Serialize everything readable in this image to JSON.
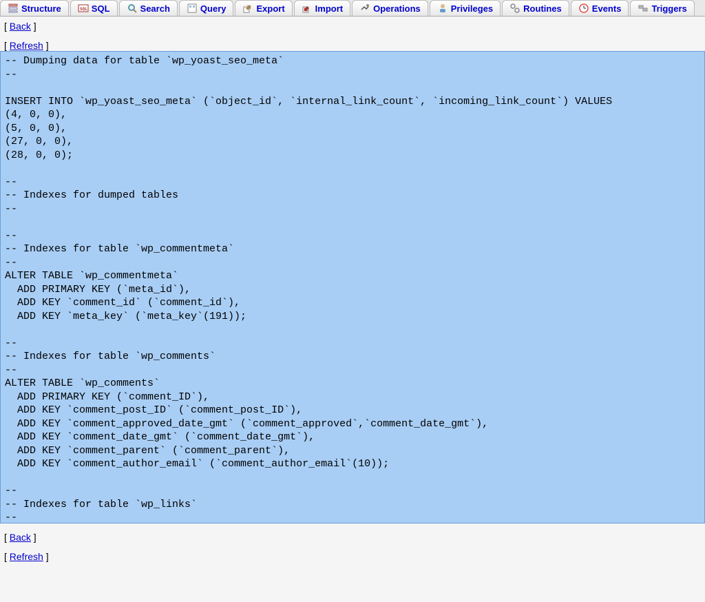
{
  "tabs": [
    {
      "label": "Structure",
      "icon": "structure-icon"
    },
    {
      "label": "SQL",
      "icon": "sql-icon"
    },
    {
      "label": "Search",
      "icon": "search-icon"
    },
    {
      "label": "Query",
      "icon": "query-icon"
    },
    {
      "label": "Export",
      "icon": "export-icon"
    },
    {
      "label": "Import",
      "icon": "import-icon"
    },
    {
      "label": "Operations",
      "icon": "operations-icon"
    },
    {
      "label": "Privileges",
      "icon": "privileges-icon"
    },
    {
      "label": "Routines",
      "icon": "routines-icon"
    },
    {
      "label": "Events",
      "icon": "events-icon"
    },
    {
      "label": "Triggers",
      "icon": "triggers-icon"
    }
  ],
  "links": {
    "back": "Back",
    "refresh": "Refresh"
  },
  "sql_text": "-- Dumping data for table `wp_yoast_seo_meta`\n--\n\nINSERT INTO `wp_yoast_seo_meta` (`object_id`, `internal_link_count`, `incoming_link_count`) VALUES\n(4, 0, 0),\n(5, 0, 0),\n(27, 0, 0),\n(28, 0, 0);\n\n--\n-- Indexes for dumped tables\n--\n\n--\n-- Indexes for table `wp_commentmeta`\n--\nALTER TABLE `wp_commentmeta`\n  ADD PRIMARY KEY (`meta_id`),\n  ADD KEY `comment_id` (`comment_id`),\n  ADD KEY `meta_key` (`meta_key`(191));\n\n--\n-- Indexes for table `wp_comments`\n--\nALTER TABLE `wp_comments`\n  ADD PRIMARY KEY (`comment_ID`),\n  ADD KEY `comment_post_ID` (`comment_post_ID`),\n  ADD KEY `comment_approved_date_gmt` (`comment_approved`,`comment_date_gmt`),\n  ADD KEY `comment_date_gmt` (`comment_date_gmt`),\n  ADD KEY `comment_parent` (`comment_parent`),\n  ADD KEY `comment_author_email` (`comment_author_email`(10));\n\n--\n-- Indexes for table `wp_links`\n--\nALTER TABLE `wp_links`\n  ADD PRIMARY KEY (`link_id`),"
}
